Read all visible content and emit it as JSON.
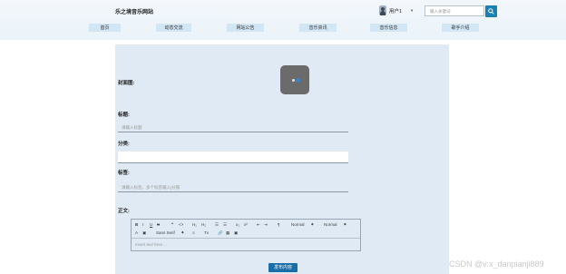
{
  "header": {
    "site_title": "乐之境音乐网站",
    "user": "用户1",
    "search_placeholder": "输入关键词"
  },
  "nav": {
    "items": [
      "首页",
      "动态交流",
      "网站公告",
      "音乐资讯",
      "音乐信息",
      "歌手介绍"
    ]
  },
  "form": {
    "cover_label": "封面图:",
    "title_label": "标题:",
    "title_placeholder": "请输入标题",
    "category_label": "分类:",
    "tags_label": "标签:",
    "tags_placeholder": "请输入标签，多个标签输入|分隔",
    "body_label": "正文:",
    "editor": {
      "bold": "B",
      "italic": "I",
      "underline": "U",
      "strike": "S",
      "quote": "❞",
      "code": "<>",
      "h1": "H₁",
      "h2": "H₂",
      "ol": "☰",
      "ul": "☰",
      "sub": "x₂",
      "sup": "x²",
      "indent_left": "⇤",
      "indent_right": "⇥",
      "rtl": "¶",
      "size_select": "Normal",
      "header_select": "Normal",
      "color": "A",
      "bg_color": "▣",
      "font_select": "Sans Serif",
      "align": "≡",
      "clean": "Tx",
      "link": "🔗",
      "image": "▦",
      "video": "▣",
      "placeholder": "Insert text here ..."
    },
    "submit_label": "发布内容"
  },
  "watermark": "CSDN @v:x_danpianji889"
}
